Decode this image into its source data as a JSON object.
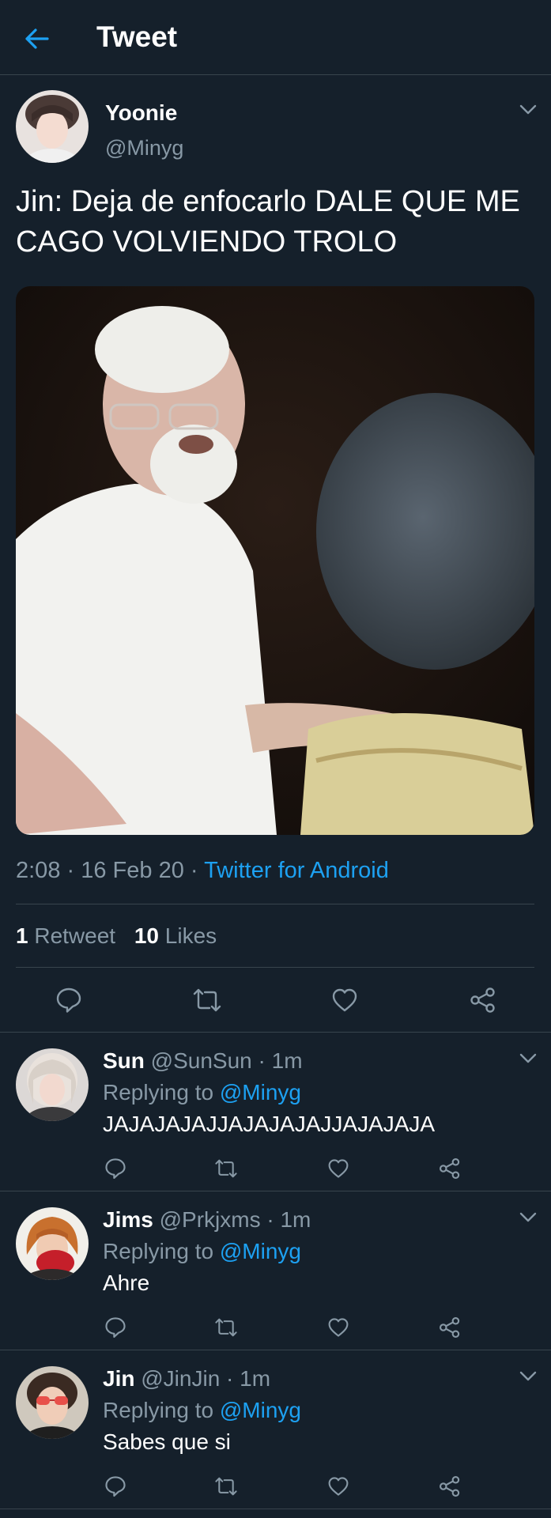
{
  "header": {
    "title": "Tweet",
    "back_icon": "arrow-left-icon"
  },
  "tweet": {
    "author_name": "Yoonie",
    "author_handle": "@Minyg",
    "text": "Jin: Deja de enfocarlo DALE QUE ME CAGO VOLVIENDO TROLO",
    "time": "2:08",
    "date": "16 Feb 20",
    "source": "Twitter for Android",
    "retweet_count": "1",
    "retweet_label": "Retweet",
    "like_count": "10",
    "like_label": "Likes"
  },
  "replying_label": "Replying to",
  "replies": [
    {
      "name": "Sun",
      "handle": "@SunSun",
      "time": "1m",
      "mention": "@Minyg",
      "text": "JAJAJAJAJJAJAJAJAJJAJAJAJA"
    },
    {
      "name": "Jims",
      "handle": "@Prkjxms",
      "time": "1m",
      "mention": "@Minyg",
      "text": "Ahre"
    },
    {
      "name": "Jin",
      "handle": "@JinJin",
      "time": "1m",
      "mention": "@Minyg",
      "text": "Sabes que si"
    }
  ],
  "colors": {
    "background": "#15202b",
    "accent": "#1da1f2",
    "muted": "#8899a6",
    "divider": "#38444d"
  }
}
